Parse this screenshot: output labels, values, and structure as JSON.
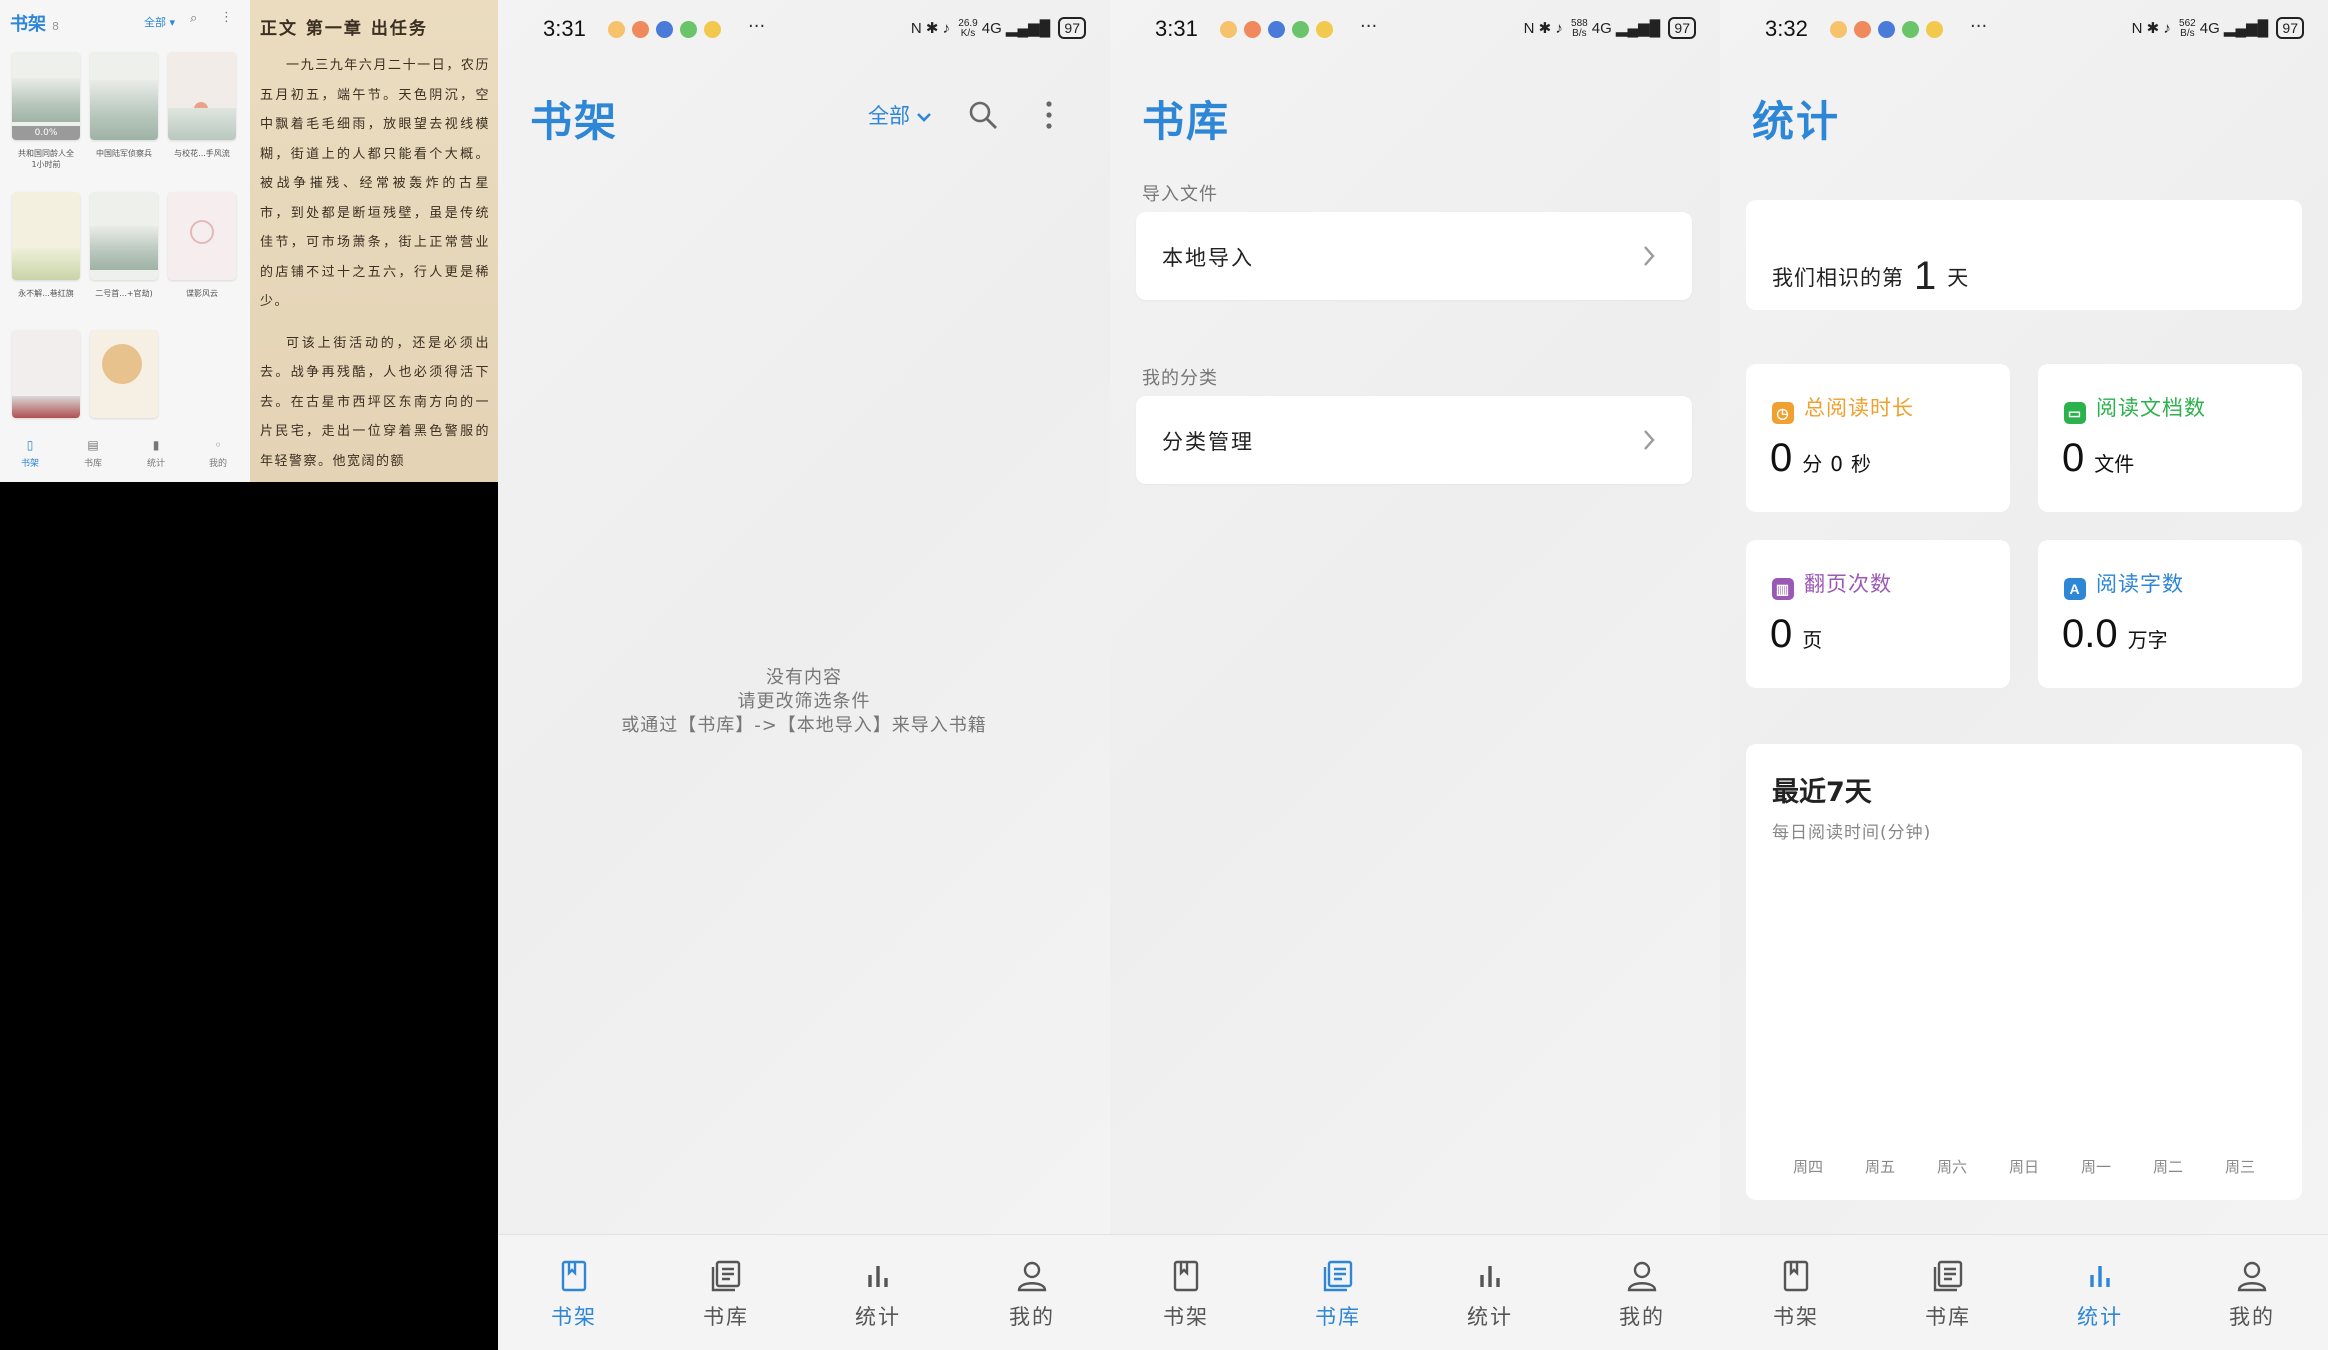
{
  "mini": {
    "title": "书架",
    "count": "8",
    "filter": "全部",
    "books": [
      {
        "caption": "共和国同龄人全",
        "sub": "1小时前",
        "progress": "0.0%"
      },
      {
        "caption": "中国陆军侦察兵",
        "sub": ""
      },
      {
        "caption": "与校花...手风流",
        "sub": ""
      },
      {
        "caption": "永不解...巷红旗",
        "sub": ""
      },
      {
        "caption": "二号首...+官劫)",
        "sub": ""
      },
      {
        "caption": "谍影风云",
        "sub": ""
      },
      {
        "caption": "",
        "sub": ""
      },
      {
        "caption": "",
        "sub": ""
      }
    ],
    "nav": [
      "书架",
      "书库",
      "统计",
      "我的"
    ]
  },
  "reader": {
    "title": "正文 第一章 出任务",
    "paragraphs": [
      "一九三九年六月二十一日，农历五月初五，端午节。天色阴沉，空中飘着毛毛细雨，放眼望去视线模糊，街道上的人都只能看个大概。被战争摧残、经常被轰炸的古星市，到处都是断垣残壁，虽是传统佳节，可市场萧条，街上正常营业的店铺不过十之五六，行人更是稀少。",
      "可该上街活动的，还是必须出去。战争再残酷，人也必须得活下去。在古星市西坪区东南方向的一片民宅，走出一位穿着黑色警服的年轻警察。他宽阔的额"
    ]
  },
  "status_bars": [
    {
      "time": "3:31",
      "speed_top": "26.9",
      "speed_bottom": "K/s",
      "network": "4G",
      "battery": "97"
    },
    {
      "time": "3:31",
      "speed_top": "588",
      "speed_bottom": "B/s",
      "network": "4G",
      "battery": "97"
    },
    {
      "time": "3:32",
      "speed_top": "562",
      "speed_bottom": "B/s",
      "network": "4G",
      "battery": "97"
    }
  ],
  "status_dots": "···",
  "shelf": {
    "title": "书架",
    "filter": "全部",
    "empty_lines": [
      "没有内容",
      "请更改筛选条件",
      "或通过【书库】->【本地导入】来导入书籍"
    ]
  },
  "library": {
    "title": "书库",
    "section_import": "导入文件",
    "local_import": "本地导入",
    "section_category": "我的分类",
    "category_manage": "分类管理"
  },
  "stats": {
    "title": "统计",
    "know_prefix": "我们相识的第",
    "know_days": "1",
    "know_suffix": "天",
    "total_time": {
      "label": "总阅读时长",
      "min": "0",
      "min_unit": "分",
      "sec": "0",
      "sec_unit": "秒",
      "color": "#f0a030"
    },
    "docs": {
      "label": "阅读文档数",
      "value": "0",
      "unit": "文件",
      "color": "#2bb24c"
    },
    "pages": {
      "label": "翻页次数",
      "value": "0",
      "unit": "页",
      "color": "#9b59b6"
    },
    "words": {
      "label": "阅读字数",
      "value": "0.0",
      "unit": "万字",
      "color": "#2d86d6",
      "icon_letter": "A"
    },
    "week_title": "最近7天",
    "week_sub": "每日阅读时间(分钟)",
    "week_days": [
      "周四",
      "周五",
      "周六",
      "周日",
      "周一",
      "周二",
      "周三"
    ]
  },
  "tabs": [
    "书架",
    "书库",
    "统计",
    "我的"
  ],
  "colors": {
    "accent": "#2d86d6"
  }
}
